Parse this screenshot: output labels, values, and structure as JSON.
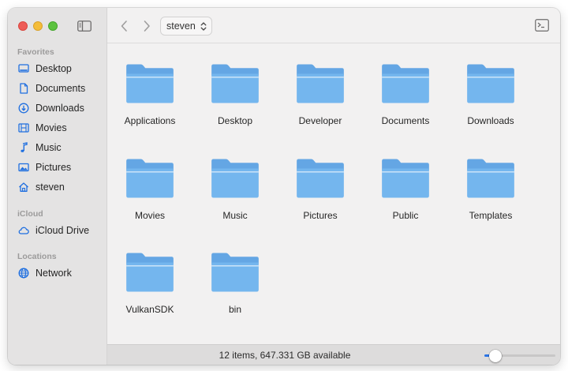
{
  "colors": {
    "accent": "#1f6fe0",
    "folder_body": "#74b6ee",
    "folder_tab": "#64a6e4",
    "folder_line": "#d5e8f9"
  },
  "sidebar": {
    "sections": [
      {
        "label": "Favorites",
        "items": [
          {
            "label": "Desktop",
            "icon": "desktop-icon"
          },
          {
            "label": "Documents",
            "icon": "document-icon"
          },
          {
            "label": "Downloads",
            "icon": "download-icon"
          },
          {
            "label": "Movies",
            "icon": "film-icon"
          },
          {
            "label": "Music",
            "icon": "music-note-icon"
          },
          {
            "label": "Pictures",
            "icon": "photo-icon"
          },
          {
            "label": "steven",
            "icon": "home-icon"
          }
        ]
      },
      {
        "label": "iCloud",
        "items": [
          {
            "label": "iCloud Drive",
            "icon": "cloud-icon"
          }
        ]
      },
      {
        "label": "Locations",
        "items": [
          {
            "label": "Network",
            "icon": "globe-icon"
          }
        ]
      }
    ]
  },
  "toolbar": {
    "path": "steven"
  },
  "content": {
    "items": [
      {
        "label": "Applications"
      },
      {
        "label": "Desktop"
      },
      {
        "label": "Developer"
      },
      {
        "label": "Documents"
      },
      {
        "label": "Downloads"
      },
      {
        "label": "Movies"
      },
      {
        "label": "Music"
      },
      {
        "label": "Pictures"
      },
      {
        "label": "Public"
      },
      {
        "label": "Templates"
      },
      {
        "label": "VulkanSDK"
      },
      {
        "label": "bin"
      }
    ]
  },
  "statusbar": {
    "text": "12 items, 647.331 GB available",
    "zoom_fraction": 0.15
  }
}
